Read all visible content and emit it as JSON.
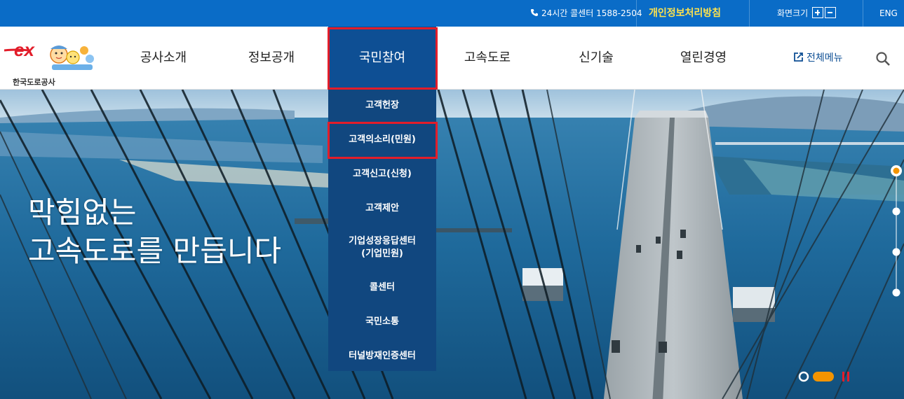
{
  "topbar": {
    "callcenter": "24시간 콜센터 1588-2504",
    "privacy": "개인정보처리방침",
    "screen_size": "화면크기",
    "lang": "ENG"
  },
  "header": {
    "logo_text": "한국도로공사",
    "nav": [
      "공사소개",
      "정보공개",
      "국민참여",
      "고속도로",
      "신기술",
      "열린경영"
    ],
    "active_nav": "국민참여",
    "all_menu": "전체메뉴"
  },
  "dropdown": {
    "items": [
      "고객헌장",
      "고객의소리(민원)",
      "고객신고(신청)",
      "고객제안",
      "기업성장응답센터\n(기업민원)",
      "콜센터",
      "국민소통",
      "터널방재인증센터"
    ],
    "selected": "고객의소리(민원)"
  },
  "hero": {
    "line1": "막힘없는",
    "line2": "고속도로를 만듭니다"
  },
  "colors": {
    "topbar": "#0a6cc7",
    "accent": "#0e4f94",
    "highlight": "#e21d2a",
    "privacy": "#ffe34d",
    "slider_active": "#f39400"
  }
}
